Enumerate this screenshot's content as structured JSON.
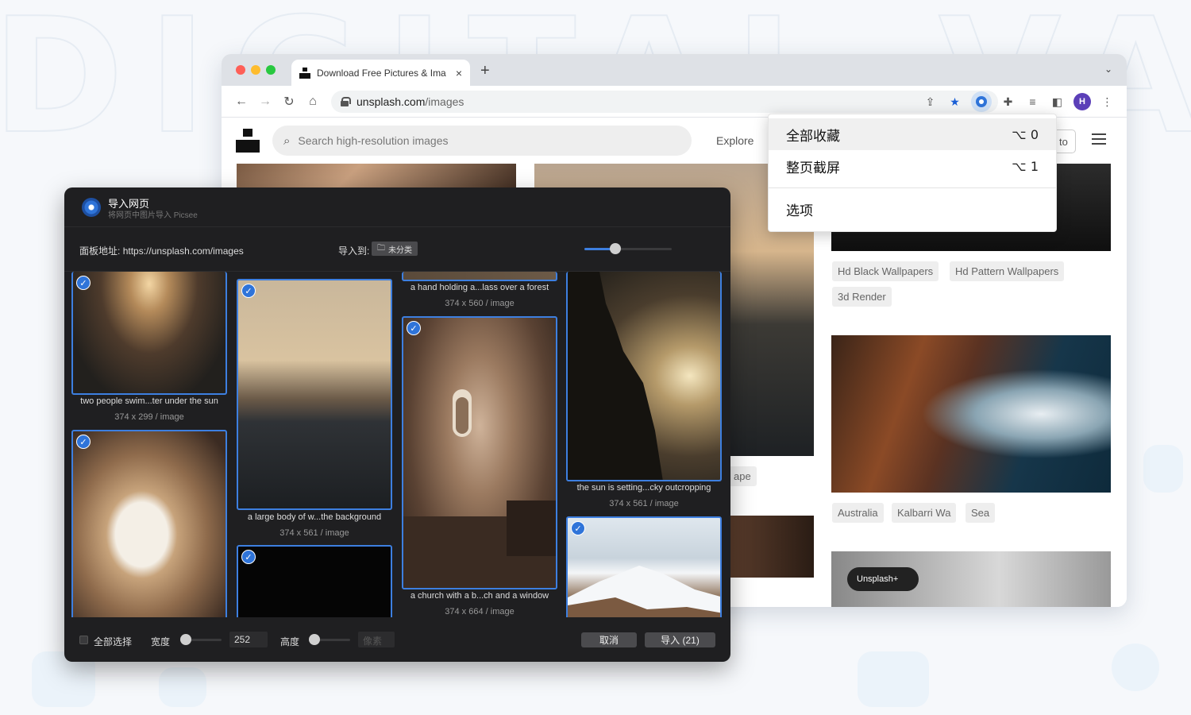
{
  "browser": {
    "tab_title": "Download Free Pictures & Ima",
    "tab_close": "×",
    "new_tab": "+",
    "tab_menu": "⌄",
    "url_host": "unsplash.com",
    "url_path": "/images",
    "avatar_letter": "H"
  },
  "unsplash": {
    "search_placeholder": "Search high-resolution images",
    "explore": "Explore",
    "submit_partial": "to",
    "chips_row1": [
      "Hd Black Wallpapers",
      "Hd Pattern Wallpapers"
    ],
    "chips_row2": [
      "3d Render"
    ],
    "chips_row3": [
      "Australia",
      "Kalbarri Wa",
      "Sea"
    ],
    "chip_partial": "ape",
    "pill_partial": "Unsplash+"
  },
  "context_menu": {
    "items": [
      {
        "label": "全部收藏",
        "shortcut": "⌥ 0"
      },
      {
        "label": "整页截屏",
        "shortcut": "⌥ 1"
      },
      {
        "label": "选项",
        "shortcut": ""
      }
    ]
  },
  "dialog": {
    "title": "导入网页",
    "subtitle": "将网页中图片导入 Picsee",
    "panel_address_label": "面板地址:",
    "panel_address": "https://unsplash.com/images",
    "import_to_label": "导入到:",
    "folder": "未分类",
    "zoom_level": 0.35,
    "cards": [
      {
        "caption": "two people swim...ter under the sun",
        "dims": "374 x 299 / image"
      },
      {
        "caption": "",
        "dims": ""
      },
      {
        "caption": "a large body of w...the background",
        "dims": "374 x 561 / image"
      },
      {
        "caption": "",
        "dims": ""
      },
      {
        "caption": "a hand holding a...lass over a forest",
        "dims": "374 x 560 / image"
      },
      {
        "caption": "a church with a b...ch and a window",
        "dims": "374 x 664 / image"
      },
      {
        "caption": "the sun is setting...cky outcropping",
        "dims": "374 x 561 / image"
      },
      {
        "caption": "",
        "dims": ""
      }
    ],
    "footer": {
      "select_all": "全部选择",
      "width_label": "宽度",
      "width_value": "252",
      "height_label": "高度",
      "height_placeholder": "像素",
      "cancel": "取消",
      "import": "导入 (21)"
    }
  },
  "colors": {
    "accent": "#2f74d9",
    "dialog_bg": "#1f1f21"
  }
}
